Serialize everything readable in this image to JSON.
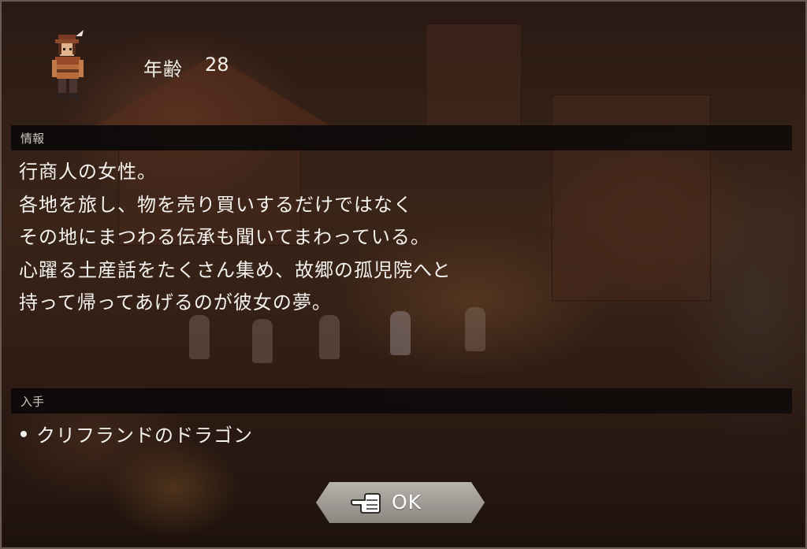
{
  "profile": {
    "age_label": "年齢",
    "age_value": "28"
  },
  "info": {
    "header": "情報",
    "lines": [
      "行商人の女性。",
      "各地を旅し、物を売り買いするだけではなく",
      "その地にまつわる伝承も聞いてまわっている。",
      "心躍る土産話をたくさん集め、故郷の孤児院へと",
      "持って帰ってあげるのが彼女の夢。"
    ]
  },
  "obtain": {
    "header": "入手",
    "items": [
      "クリフランドのドラゴン"
    ]
  },
  "ok_button": {
    "label": "OK",
    "icon": "pointing-hand-icon"
  },
  "colors": {
    "text": "#f4f2ee",
    "section_bar": "#0e0a09",
    "button": "#a8a29d"
  }
}
